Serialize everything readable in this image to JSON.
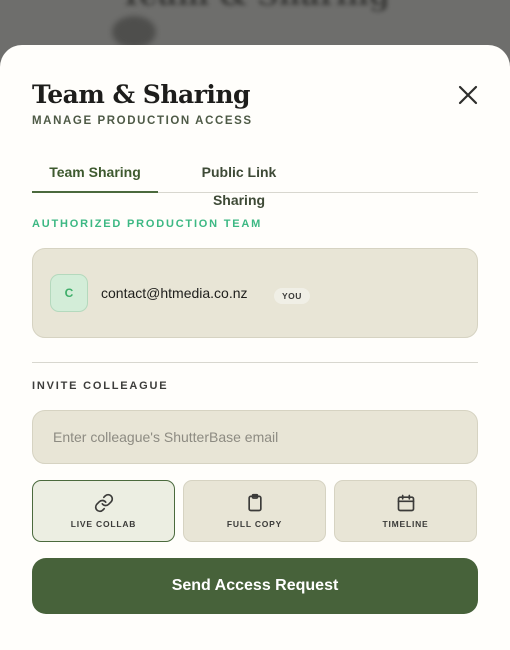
{
  "background": {
    "title": "Team & Sharing"
  },
  "modal": {
    "title": "Team & Sharing",
    "subtitle": "MANAGE PRODUCTION ACCESS",
    "close_icon": "close-icon"
  },
  "tabs": [
    {
      "label": "Team Sharing",
      "active": true
    },
    {
      "label": "Public Link Sharing",
      "active": false
    }
  ],
  "team": {
    "section_label": "AUTHORIZED PRODUCTION TEAM",
    "members": [
      {
        "initial": "C",
        "email": "contact@htmedia.co.nz",
        "badge": "YOU"
      }
    ]
  },
  "invite": {
    "section_label": "INVITE COLLEAGUE",
    "placeholder": "Enter colleague's ShutterBase email",
    "value": "",
    "modes": [
      {
        "label": "LIVE COLLAB",
        "icon": "link-icon",
        "selected": true
      },
      {
        "label": "FULL COPY",
        "icon": "clipboard-icon",
        "selected": false
      },
      {
        "label": "TIMELINE",
        "icon": "calendar-icon",
        "selected": false
      }
    ],
    "submit_label": "Send Access Request"
  },
  "colors": {
    "accent": "#47623a",
    "section_green": "#3cb883",
    "card_bg": "#e8e5d6"
  }
}
